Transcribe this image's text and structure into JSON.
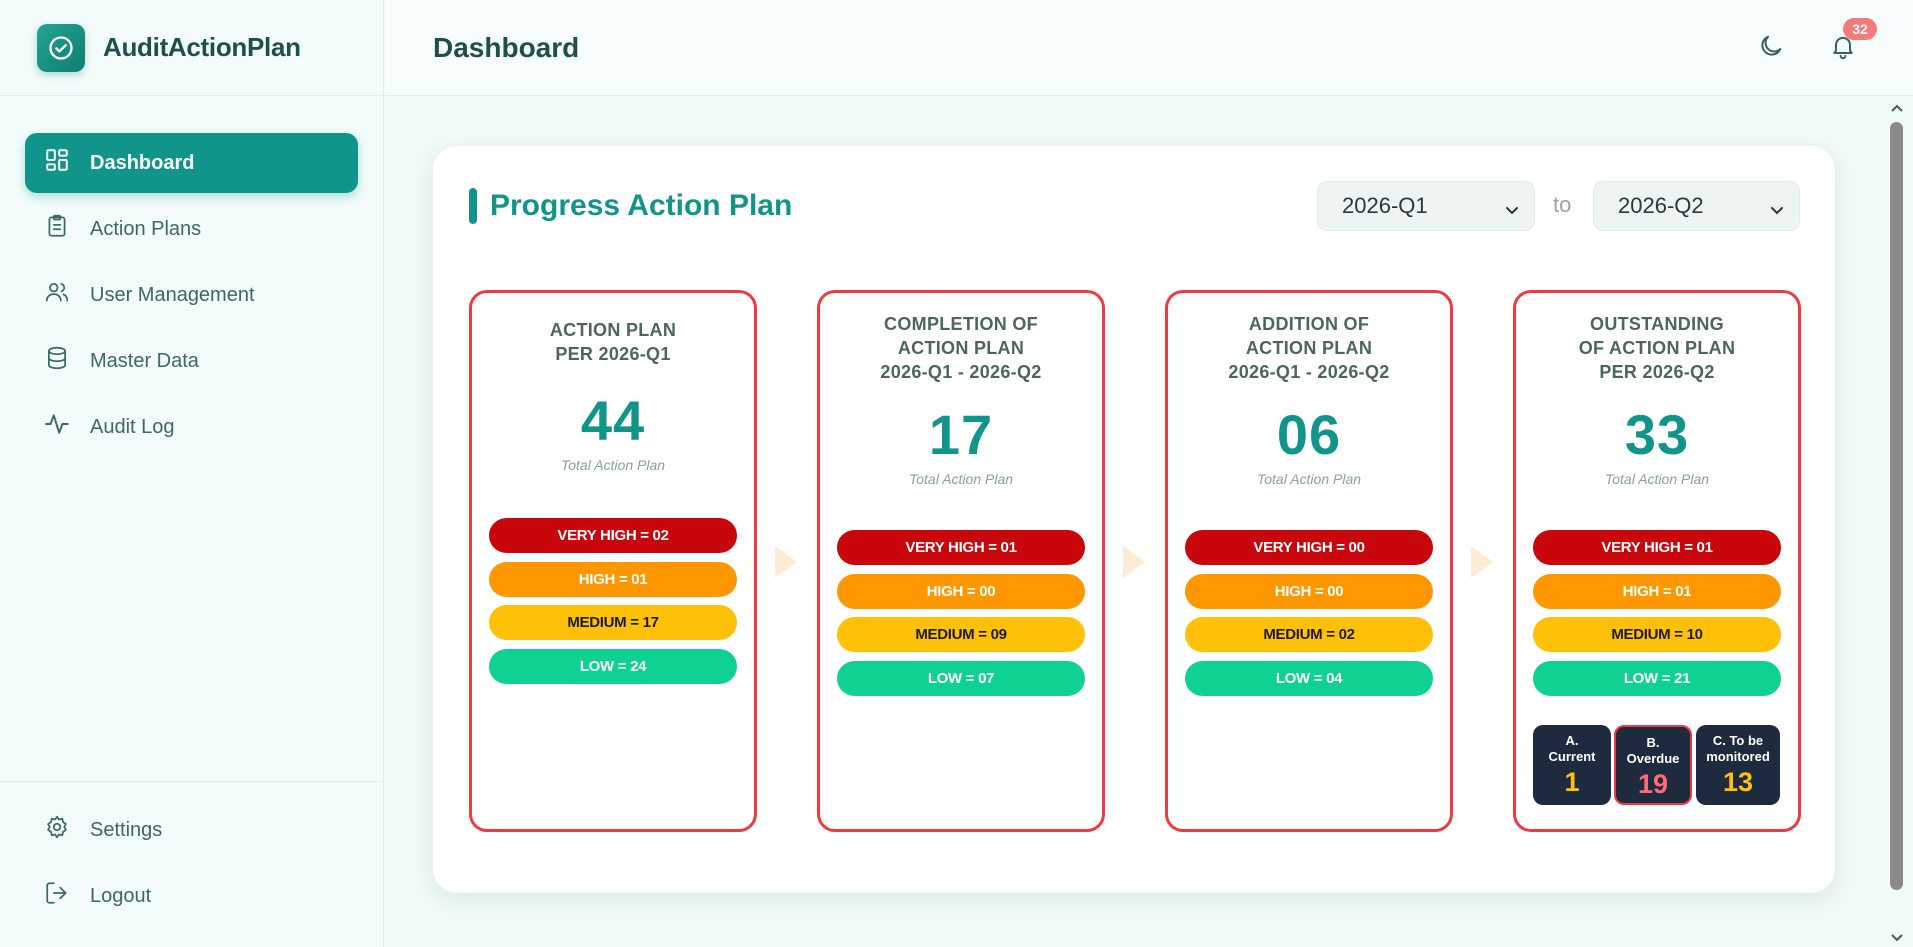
{
  "app": {
    "brand": "AuditActionPlan",
    "notification_count": "32"
  },
  "sidebar": {
    "items": [
      {
        "label": "Dashboard",
        "icon": "dashboard-grid-icon",
        "active": true
      },
      {
        "label": "Action Plans",
        "icon": "clipboard-icon"
      },
      {
        "label": "User Management",
        "icon": "users-icon"
      },
      {
        "label": "Master Data",
        "icon": "database-icon"
      },
      {
        "label": "Audit Log",
        "icon": "activity-icon"
      }
    ],
    "bottom": [
      {
        "label": "Settings",
        "icon": "gear-icon"
      },
      {
        "label": "Logout",
        "icon": "logout-icon"
      }
    ]
  },
  "header": {
    "title": "Dashboard"
  },
  "main": {
    "title": "Progress Action Plan",
    "period_from": "2026-Q1",
    "period_to": "2026-Q2",
    "to_label": "to",
    "colors": {
      "accent": "#11958a",
      "panel_border": "#ef3a42",
      "very_high": "#c8060c",
      "high": "#ff9800",
      "medium": "#ffc107",
      "low": "#0fd292"
    },
    "panels": [
      {
        "heading": [
          "ACTION PLAN",
          "PER 2026-Q1"
        ],
        "total": "44",
        "total_label": "Total Action Plan",
        "levels": [
          "VERY HIGH = 02",
          "HIGH = 01",
          "MEDIUM = 17",
          "LOW = 24"
        ]
      },
      {
        "heading": [
          "COMPLETION OF",
          "ACTION PLAN",
          "2026-Q1 - 2026-Q2"
        ],
        "total": "17",
        "total_label": "Total Action Plan",
        "levels": [
          "VERY HIGH = 01",
          "HIGH = 00",
          "MEDIUM = 09",
          "LOW = 07"
        ]
      },
      {
        "heading": [
          "ADDITION OF",
          "ACTION PLAN",
          "2026-Q1 - 2026-Q2"
        ],
        "total": "06",
        "total_label": "Total Action Plan",
        "levels": [
          "VERY HIGH = 00",
          "HIGH = 00",
          "MEDIUM = 02",
          "LOW = 04"
        ]
      },
      {
        "heading": [
          "OUTSTANDING",
          "OF ACTION PLAN",
          "PER 2026-Q2"
        ],
        "total": "33",
        "total_label": "Total Action Plan",
        "levels": [
          "VERY HIGH = 01",
          "HIGH = 01",
          "MEDIUM = 10",
          "LOW = 21"
        ],
        "status": [
          {
            "label": [
              "A.",
              "Current"
            ],
            "value": "1",
            "color": "#ffc107"
          },
          {
            "label": [
              "B.",
              "Overdue"
            ],
            "value": "19",
            "color": "#ff6b78"
          },
          {
            "label": [
              "C. To be",
              "monitored"
            ],
            "value": "13",
            "color": "#ffc107"
          }
        ]
      }
    ]
  }
}
